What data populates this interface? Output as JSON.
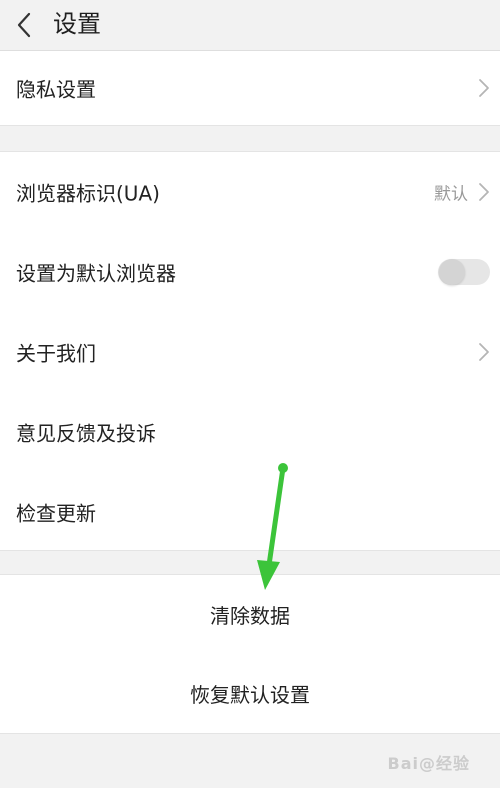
{
  "header": {
    "title": "设置"
  },
  "groups": {
    "first": {
      "items": [
        {
          "label": "隐私设置"
        }
      ]
    },
    "second": {
      "items": [
        {
          "label": "浏览器标识(UA)",
          "value": "默认"
        },
        {
          "label": "设置为默认浏览器",
          "toggle_on": false
        },
        {
          "label": "关于我们"
        },
        {
          "label": "意见反馈及投诉"
        },
        {
          "label": "检查更新"
        }
      ]
    },
    "actions": {
      "items": [
        {
          "label": "清除数据"
        },
        {
          "label": "恢复默认设置"
        }
      ]
    }
  },
  "annotation": {
    "arrow_color": "#3cc43a"
  },
  "watermark": {
    "text": "Bai@经验"
  },
  "colors": {
    "background": "#f2f2f2",
    "card": "#ffffff",
    "secondary_text": "#9a9a9a"
  }
}
